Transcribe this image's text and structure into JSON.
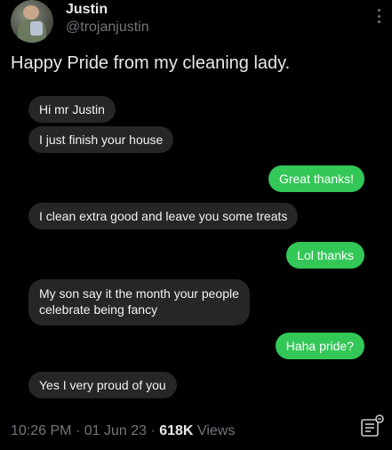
{
  "author": {
    "name": "Justin",
    "handle": "@trojanjustin"
  },
  "tweet_text": "Happy Pride from my cleaning lady.",
  "messages": [
    {
      "from": "them",
      "text": "Hi mr Justin"
    },
    {
      "from": "them",
      "text": "I just finish your house"
    },
    {
      "from": "me",
      "text": "Great thanks!"
    },
    {
      "from": "them",
      "text": "I clean extra good and leave you some treats"
    },
    {
      "from": "me",
      "text": "Lol thanks"
    },
    {
      "from": "them",
      "text": "My son say it the month your people"
    },
    {
      "from": "them",
      "text": "celebrate being fancy"
    },
    {
      "from": "me",
      "text": "Haha pride?"
    },
    {
      "from": "them",
      "text": "Yes I very proud of you"
    }
  ],
  "meta": {
    "time": "10:26 PM",
    "sep1": "·",
    "date": "01 Jun 23",
    "sep2": "·",
    "views_count": "618K",
    "views_label": "Views"
  },
  "icons": {
    "more": "more-vertical-icon",
    "analytics": "analytics-icon"
  },
  "colors": {
    "incoming_bubble": "#262628",
    "outgoing_bubble": "#33c758",
    "secondary_text": "#71767b"
  }
}
